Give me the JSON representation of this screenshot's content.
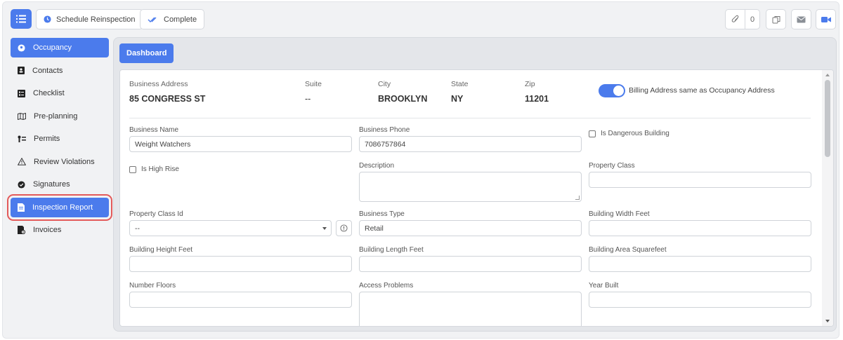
{
  "toolbar": {
    "schedule_label": "Schedule Reinspection",
    "complete_label": "Complete",
    "attachment_count": "0"
  },
  "sidebar": {
    "items": [
      {
        "label": "Occupancy",
        "icon": "location-pin-icon"
      },
      {
        "label": "Contacts",
        "icon": "contact-card-icon"
      },
      {
        "label": "Checklist",
        "icon": "checklist-icon"
      },
      {
        "label": "Pre-planning",
        "icon": "map-icon"
      },
      {
        "label": "Permits",
        "icon": "permits-icon"
      },
      {
        "label": "Review Violations",
        "icon": "warning-icon"
      },
      {
        "label": "Signatures",
        "icon": "check-circle-icon"
      },
      {
        "label": "Inspection Report",
        "icon": "report-icon"
      },
      {
        "label": "Invoices",
        "icon": "invoice-icon"
      }
    ]
  },
  "main": {
    "dashboard_label": "Dashboard",
    "address": {
      "business_address_label": "Business Address",
      "business_address": "85 CONGRESS ST",
      "suite_label": "Suite",
      "suite": "--",
      "city_label": "City",
      "city": "BROOKLYN",
      "state_label": "State",
      "state": "NY",
      "zip_label": "Zip",
      "zip": "11201",
      "billing_toggle_label": "Billing Address same as Occupancy Address",
      "billing_toggle_on": true
    },
    "form": {
      "business_name_label": "Business Name",
      "business_name": "Weight Watchers",
      "business_phone_label": "Business Phone",
      "business_phone": "7086757864",
      "dangerous_label": "Is Dangerous Building",
      "high_rise_label": "Is High Rise",
      "description_label": "Description",
      "property_class_label": "Property Class",
      "property_class_id_label": "Property Class Id",
      "property_class_id": "--",
      "business_type_label": "Business Type",
      "business_type": "Retail",
      "building_width_label": "Building Width Feet",
      "building_height_label": "Building Height Feet",
      "building_length_label": "Building Length Feet",
      "building_area_label": "Building Area Squarefeet",
      "number_floors_label": "Number Floors",
      "access_problems_label": "Access Problems",
      "year_built_label": "Year Built"
    }
  },
  "colors": {
    "accent": "#4b7bec",
    "highlight_outline": "#e35a5a"
  }
}
